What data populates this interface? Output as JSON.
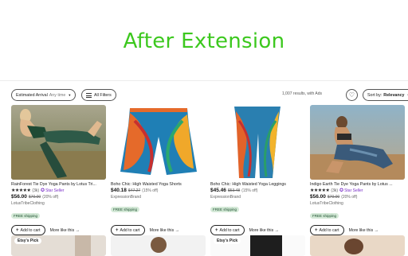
{
  "hero": {
    "title": "After Extension"
  },
  "toolbar": {
    "arrival_label": "Estimated Arrival",
    "arrival_value": "Any time",
    "filters_label": "All Filters",
    "results": "1,007 results, with Ads",
    "sort_label": "Sort by:",
    "sort_value": "Relevancy"
  },
  "products": [
    {
      "title": "RainForest Tie Dye Yoga Pants by Lotus Tri...",
      "stars": "★★★★★",
      "review_count": "(3k)",
      "star_seller": "Star Seller",
      "price": "$56.00",
      "original_price": "$70.00",
      "discount": "(20% off)",
      "shop": "LotusTribeClothing",
      "shipping": "FREE shipping",
      "add_to_cart": "Add to cart",
      "more_like_this": "More like this"
    },
    {
      "title": "Boho Chic: High Waisted Yoga Shorts",
      "price": "$40.18",
      "original_price": "$47.27",
      "discount": "(15% off)",
      "shop": "ExpressionBrand",
      "shipping": "FREE shipping",
      "add_to_cart": "Add to cart",
      "more_like_this": "More like this"
    },
    {
      "title": "Boho Chic: High Waisted Yoga Leggings",
      "price": "$45.46",
      "original_price": "$53.48",
      "discount": "(15% off)",
      "shop": "ExpressionBrand",
      "shipping": "FREE shipping",
      "add_to_cart": "Add to cart",
      "more_like_this": "More like this"
    },
    {
      "title": "Indigo Earth Tie Dye Yoga Pants by Lotus ...",
      "stars": "★★★★★",
      "review_count": "(3k)",
      "star_seller": "Star Seller",
      "price": "$56.00",
      "original_price": "$70.00",
      "discount": "(20% off)",
      "shop": "LotusTribeClothing",
      "shipping": "FREE shipping",
      "add_to_cart": "Add to cart",
      "more_like_this": "More like this"
    }
  ],
  "bottom_badges": [
    "Etsy's Pick",
    "Etsy's Pick"
  ],
  "colors": {
    "hero_title": "#3cc81e",
    "star_seller": "#7a2fc8",
    "shipping_badge": "#d4e9d7"
  }
}
